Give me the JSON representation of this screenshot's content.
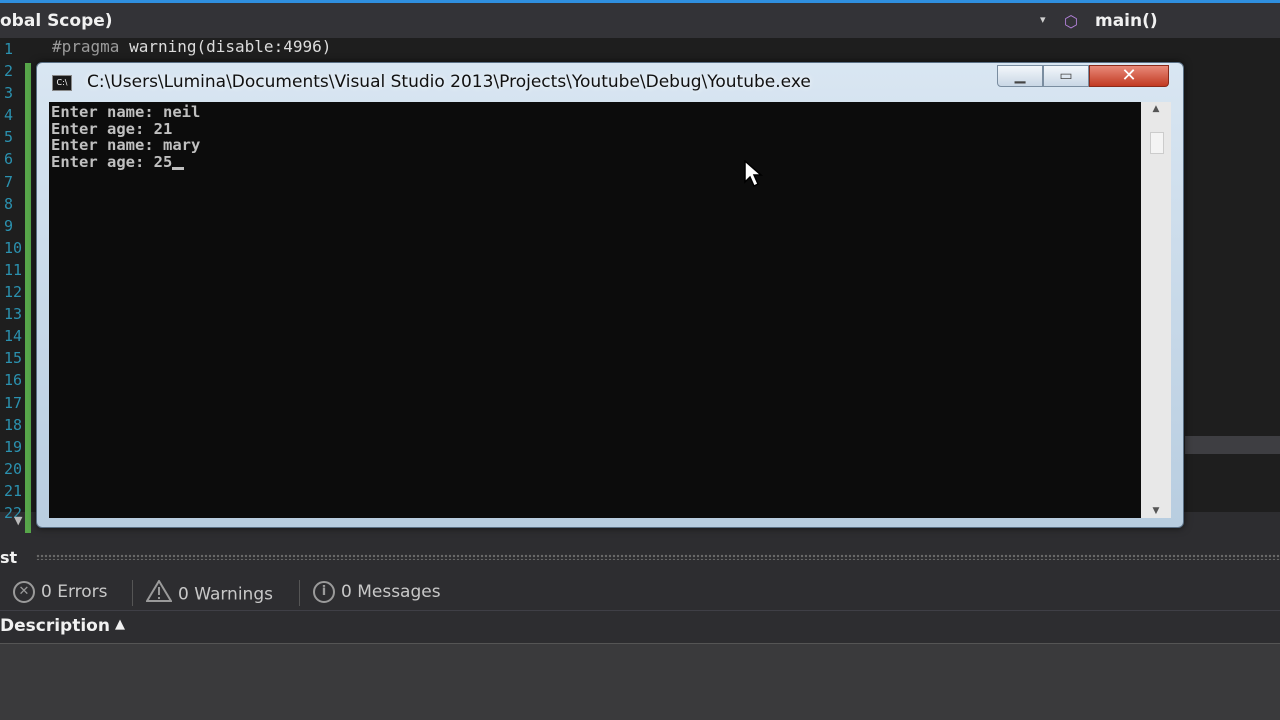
{
  "scope_bar": {
    "left_label": "obal Scope)",
    "dropdown_arrow": "▾",
    "right_label": "main()",
    "right_icon": "method-cube-icon"
  },
  "editor": {
    "line_numbers": [
      "1",
      "2",
      "3",
      "4",
      "5",
      "6",
      "7",
      "8",
      "9",
      "10",
      "11",
      "12",
      "13",
      "14",
      "15",
      "16",
      "17",
      "18",
      "19",
      "20",
      "21",
      "22"
    ],
    "code_line_1_directive": "#pragma",
    "code_line_1_rest": " warning(disable:4996)"
  },
  "console": {
    "title": "C:\\Users\\Lumina\\Documents\\Visual Studio 2013\\Projects\\Youtube\\Debug\\Youtube.exe",
    "minimize_icon": "▁",
    "maximize_icon": "▭",
    "close_icon": "✕",
    "lines": [
      "Enter name: neil",
      "Enter age: 21",
      "Enter name: mary",
      "Enter age: 25"
    ]
  },
  "error_list": {
    "title": "st",
    "errors_label": "0 Errors",
    "warnings_label": "0 Warnings",
    "messages_label": "0 Messages",
    "description_header": "Description",
    "sort_indicator": "▲"
  },
  "colors": {
    "ide_background": "#2d2d30",
    "editor_background": "#1e1e1e",
    "line_number": "#2b91af",
    "change_bar": "#57a64a",
    "console_background": "#0c0c0c",
    "console_text": "#c0c0c0",
    "close_button": "#c23a22"
  }
}
